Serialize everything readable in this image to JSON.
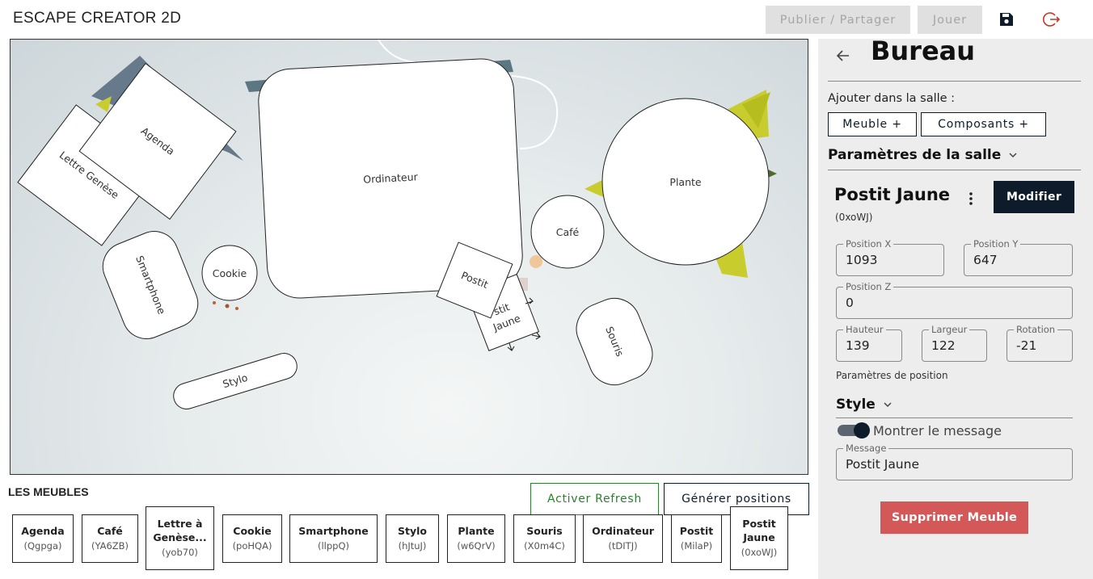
{
  "header": {
    "app_title": "ESCAPE CREATOR 2D",
    "publish_label": "Publier / Partager",
    "play_label": "Jouer",
    "save_icon": "save-icon",
    "logout_icon": "logout-icon"
  },
  "canvas": {
    "shapes": {
      "lettre": "Lettre Genèse",
      "agenda": "Agenda",
      "ordinateur": "Ordinateur",
      "plante": "Plante",
      "cafe": "Café",
      "smartphone": "Smartphone",
      "cookie": "Cookie",
      "postit": "Postit",
      "postit_jaune": "Postit Jaune",
      "souris": "Souris",
      "stylo": "Stylo"
    }
  },
  "meubles": {
    "title": "LES MEUBLES",
    "refresh_label": "Activer Refresh",
    "generate_label": "Générer positions",
    "items": [
      {
        "name": "Agenda",
        "id": "(Qgpga)"
      },
      {
        "name": "Café",
        "id": "(YA6ZB)"
      },
      {
        "name": "Lettre à Genèse...",
        "id": "(yob70)"
      },
      {
        "name": "Cookie",
        "id": "(poHQA)"
      },
      {
        "name": "Smartphone",
        "id": "(llppQ)"
      },
      {
        "name": "Stylo",
        "id": "(hJtuJ)"
      },
      {
        "name": "Plante",
        "id": "(w6QrV)"
      },
      {
        "name": "Souris",
        "id": "(X0m4C)"
      },
      {
        "name": "Ordinateur",
        "id": "(tDITJ)"
      },
      {
        "name": "Postit",
        "id": "(MilaP)"
      },
      {
        "name": "Postit Jaune",
        "id": "(0xoWJ)"
      }
    ]
  },
  "panel": {
    "room_title": "Bureau",
    "add_label": "Ajouter dans la salle :",
    "meuble_btn": "Meuble +",
    "composants_btn": "Composants +",
    "room_params_title": "Paramètres de la salle",
    "item_title": "Postit Jaune",
    "item_id": "(0xoWJ)",
    "modify_label": "Modifier",
    "fields": {
      "pos_x": {
        "label": "Position X",
        "value": "1093"
      },
      "pos_y": {
        "label": "Position Y",
        "value": "647"
      },
      "pos_z": {
        "label": "Position Z",
        "value": "0"
      },
      "hauteur": {
        "label": "Hauteur",
        "value": "139"
      },
      "largeur": {
        "label": "Largeur",
        "value": "122"
      },
      "rotation": {
        "label": "Rotation",
        "value": "-21"
      },
      "message": {
        "label": "Message",
        "value": "Postit Jaune"
      }
    },
    "position_params_label": "Paramètres de position",
    "style_title": "Style",
    "show_message_label": "Montrer le message",
    "show_message_on": true,
    "delete_label": "Supprimer Meuble"
  },
  "colors": {
    "dark": "#0d1b2a",
    "danger": "#d45858",
    "success": "#2e7d32",
    "panel_bg": "#ededed"
  }
}
